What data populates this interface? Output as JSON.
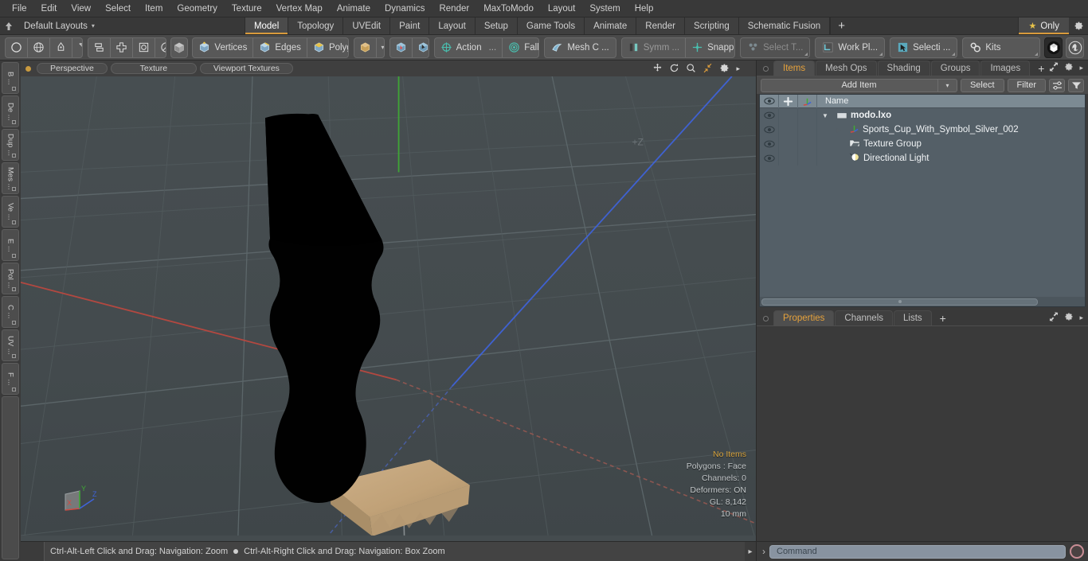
{
  "menu": {
    "items": [
      "File",
      "Edit",
      "View",
      "Select",
      "Item",
      "Geometry",
      "Texture",
      "Vertex Map",
      "Animate",
      "Dynamics",
      "Render",
      "MaxToModo",
      "Layout",
      "System",
      "Help"
    ]
  },
  "layout_bar": {
    "home_icon": "home-arrow-icon",
    "preset_label": "Default Layouts",
    "caret": "▾",
    "tabs": [
      {
        "label": "Model",
        "active": true
      },
      {
        "label": "Topology",
        "active": false
      },
      {
        "label": "UVEdit",
        "active": false
      },
      {
        "label": "Paint",
        "active": false
      },
      {
        "label": "Layout",
        "active": false
      },
      {
        "label": "Setup",
        "active": false
      },
      {
        "label": "Game Tools",
        "active": false
      },
      {
        "label": "Animate",
        "active": false
      },
      {
        "label": "Render",
        "active": false
      },
      {
        "label": "Scripting",
        "active": false
      },
      {
        "label": "Schematic Fusion",
        "active": false
      }
    ],
    "add_tab": "+",
    "only_label": "Only",
    "only_star": "★",
    "gear_icon": "gear-icon",
    "accent": "#d89a3c"
  },
  "toolbar": {
    "primitives": [
      "circle-primitive-icon",
      "sphere-primitive-icon",
      "pen-tool-icon",
      "curve-tool-icon"
    ],
    "arrange": [
      "mirror-icon",
      "align-icon",
      "center-icon",
      "radial-icon"
    ],
    "select_mode_icon": "cube-solid-icon",
    "selection_modes": [
      {
        "label": "Vertices",
        "icon": "vertices-cube-icon"
      },
      {
        "label": "Edges",
        "icon": "edges-cube-icon"
      },
      {
        "label": "Polygons",
        "icon": "polygons-cube-icon"
      }
    ],
    "items_mode_icon": "items-cube-icon",
    "items_caret": "▾",
    "falloff_pair": [
      "select-through-icon",
      "select-backface-icon"
    ],
    "action_label": "Action",
    "action_ellipsis": "...",
    "action_icon": "action-center-icon",
    "falloff_label": "Falloff",
    "falloff_icon": "falloff-icon",
    "mesh_constraint_label": "Mesh C ...",
    "mesh_constraint_icon": "mesh-constraint-icon",
    "symmetry_label": "Symm ...",
    "symmetry_icon": "symmetry-icon",
    "snapping_label": "Snapping",
    "snapping_icon": "snapping-icon",
    "select_through_label": "Select T...",
    "select_through_icon": "select-through-tool-icon",
    "work_plane_label": "Work Pl...",
    "work_plane_icon": "work-plane-icon",
    "selection_label": "Selecti ...",
    "selection_icon": "selection-arrow-icon",
    "kits_label": "Kits",
    "kits_icon": "gears-icon",
    "modo_badge_icon": "modo-cube-icon",
    "unreal_badge_icon": "unreal-engine-icon"
  },
  "left_strip": {
    "tabs": [
      "B ...",
      "De ...",
      "Dup ...",
      "Mes ...",
      "Ve ...",
      "E ...",
      "Pol ...",
      "C ...",
      "UV ...",
      "F ..."
    ]
  },
  "viewport": {
    "status_dot": "active-viewport-dot",
    "pills": [
      "Perspective",
      "Texture",
      "Viewport Textures"
    ],
    "icons": [
      "pan-icon",
      "rotate-icon",
      "zoom-icon",
      "fit-icon",
      "gear-icon",
      "chevron-right-icon"
    ],
    "axis_label_z": "+Z",
    "gizmo": {
      "x": "X",
      "y": "Y",
      "z": "Z"
    },
    "stats": {
      "selection": "No Items",
      "polygons": "Polygons : Face",
      "channels": "Channels: 0",
      "deformers": "Deformers: ON",
      "gl": "GL: 8,142",
      "grid": "10 mm"
    },
    "colors": {
      "background": "#454c4f",
      "axis_x": "#c0392b",
      "axis_y": "#3ba832",
      "axis_z": "#3b5fd4",
      "model_body": "#000000",
      "model_base": "#c3a477"
    }
  },
  "status_bar": {
    "text_left": "Ctrl-Alt-Left Click and Drag: Navigation: Zoom",
    "separator": "●",
    "text_right": "Ctrl-Alt-Right Click and Drag: Navigation: Box Zoom",
    "arrow": "▸"
  },
  "items_panel": {
    "tabs": [
      {
        "label": "Items",
        "active": true
      },
      {
        "label": "Mesh Ops",
        "active": false
      },
      {
        "label": "Shading",
        "active": false
      },
      {
        "label": "Groups",
        "active": false
      },
      {
        "label": "Images",
        "active": false
      }
    ],
    "add_tab": "+",
    "header_icons": [
      "expand-icon",
      "gear-icon",
      "chevron-right-icon"
    ],
    "add_item_label": "Add Item",
    "add_item_caret": "▾",
    "select_label": "Select",
    "filter_label": "Filter",
    "list_options_icon": "list-options-icon",
    "filter_funnel_icon": "funnel-icon",
    "columns": {
      "visibility_icon": "eye-icon",
      "lock_icon": "lock-cross-icon",
      "transform_icon": "axis-icon",
      "name": "Name"
    },
    "rows": [
      {
        "name": "modo.lxo",
        "icon": "scene-clapper-icon",
        "depth": 0,
        "bold": true,
        "expander": "▼",
        "eye": "eye-icon"
      },
      {
        "name": "Sports_Cup_With_Symbol_Silver_002",
        "icon": "mesh-axis-icon",
        "depth": 1,
        "bold": false,
        "expander": "▶",
        "eye": "eye-icon"
      },
      {
        "name": "Texture Group",
        "icon": "folder-texture-icon",
        "depth": 1,
        "bold": false,
        "expander": "",
        "eye": "eye-icon"
      },
      {
        "name": "Directional Light",
        "icon": "light-icon",
        "depth": 1,
        "bold": false,
        "expander": "",
        "eye": "eye-icon"
      }
    ]
  },
  "properties_panel": {
    "tabs": [
      {
        "label": "Properties",
        "active": true
      },
      {
        "label": "Channels",
        "active": false
      },
      {
        "label": "Lists",
        "active": false
      }
    ],
    "add_tab": "+",
    "header_icons": [
      "expand-icon",
      "gear-icon",
      "chevron-right-icon"
    ]
  },
  "command_bar": {
    "prompt": "›",
    "placeholder": "Command",
    "record_icon": "record-circle-icon"
  }
}
